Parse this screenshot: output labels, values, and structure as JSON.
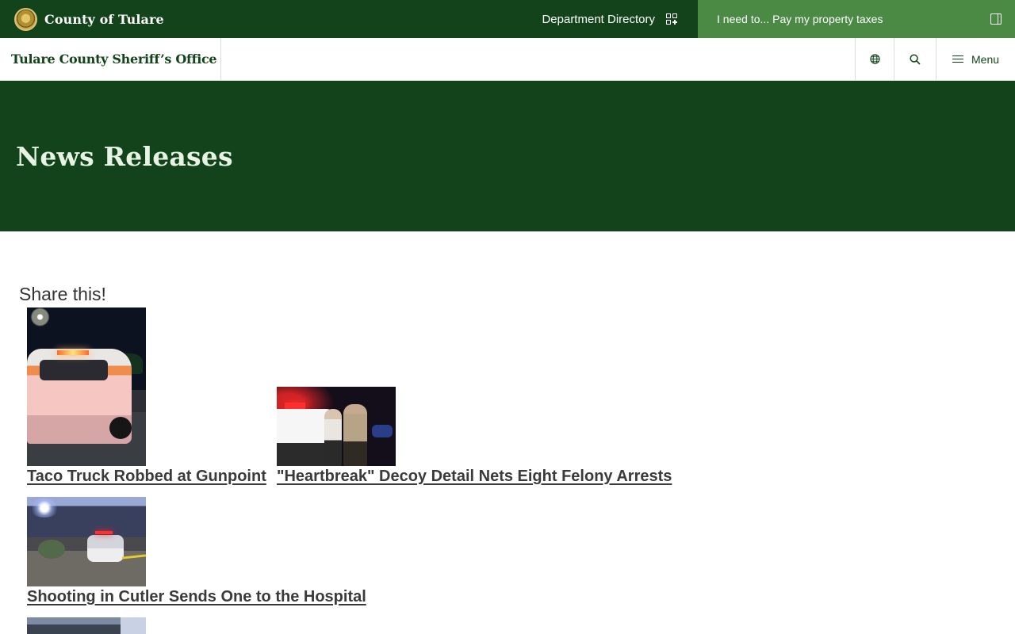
{
  "county_bar": {
    "name": "County of Tulare",
    "department_directory": "Department Directory",
    "need_prefix": "I need to...",
    "need_action": "Pay my property taxes"
  },
  "office_bar": {
    "title": "Tulare County Sheriff’s Office",
    "menu_label": "Menu",
    "icons": [
      "globe-icon",
      "search-icon",
      "hamburger-icon"
    ]
  },
  "hero": {
    "title": "News Releases"
  },
  "share": {
    "label": "Share this!"
  },
  "news": [
    {
      "title": "Taco Truck Robbed at Gunpoint"
    },
    {
      "title": "\"Heartbreak\" Decoy Detail Nets Eight Felony Arrests"
    },
    {
      "title": "Shooting in Cutler Sends One to the Hospital"
    }
  ],
  "colors": {
    "brand_dark_green": "#13431a",
    "brand_light_green": "#4b8a45",
    "hero_title": "#e7f3e4",
    "link_text": "#3a3a3a"
  }
}
